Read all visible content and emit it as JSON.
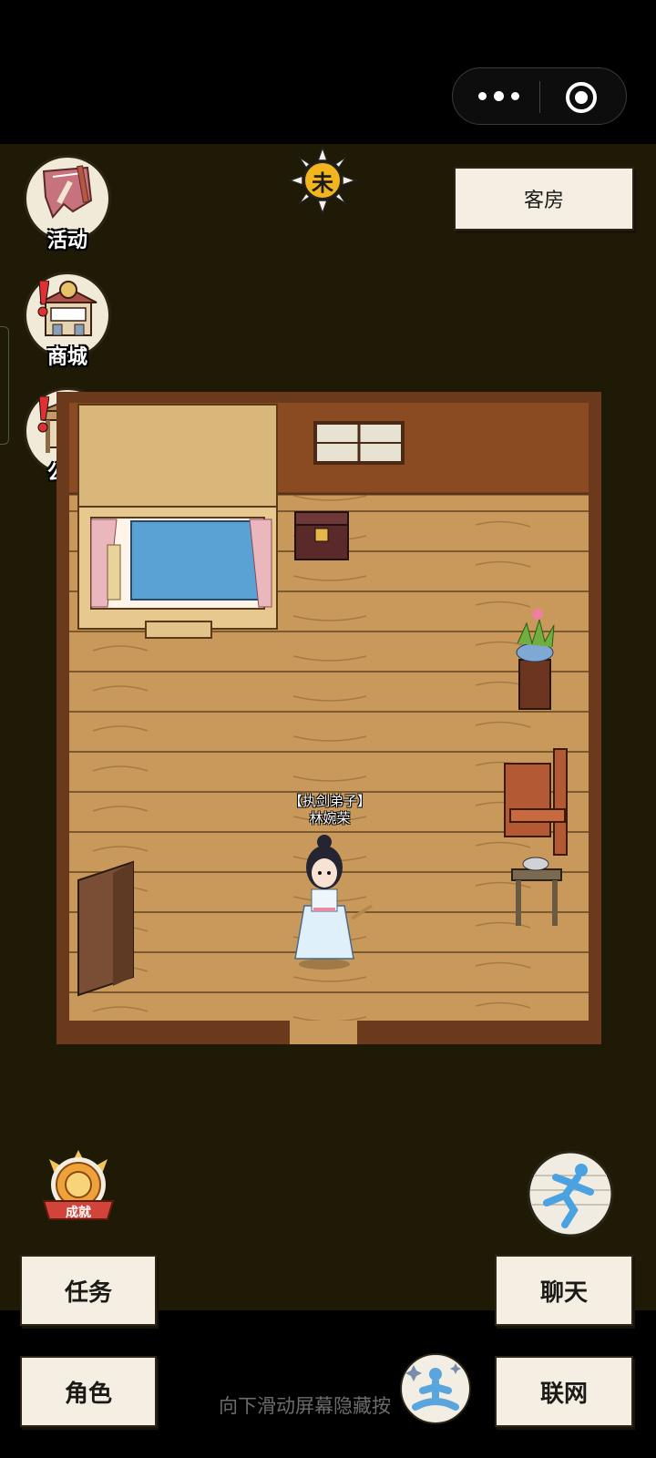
{
  "capsule": {
    "more_icon": "more-dots-icon",
    "close_icon": "target-circle-icon"
  },
  "scene": {
    "location_label": "客房",
    "time_badge": "未",
    "menu": [
      {
        "label": "活动",
        "icon": "scroll-flag-icon",
        "alert": false
      },
      {
        "label": "商城",
        "icon": "shop-icon",
        "alert": true
      },
      {
        "label": "公告",
        "icon": "notice-board-icon",
        "alert": true
      }
    ],
    "character": {
      "title": "【执剑弟子】",
      "name": "林婉荣"
    },
    "achievement_label": "成就",
    "run_icon": "running-man-icon",
    "meditate_icon": "meditation-icon"
  },
  "buttons": {
    "task": "任务",
    "chat": "聊天",
    "role": "角色",
    "network": "联网"
  },
  "hint": "向下滑动屏幕隐藏按",
  "colors": {
    "background": "#1f1a06",
    "floor": "#c89a5a",
    "wall": "#8a4a22",
    "paper": "#f4efe2"
  }
}
